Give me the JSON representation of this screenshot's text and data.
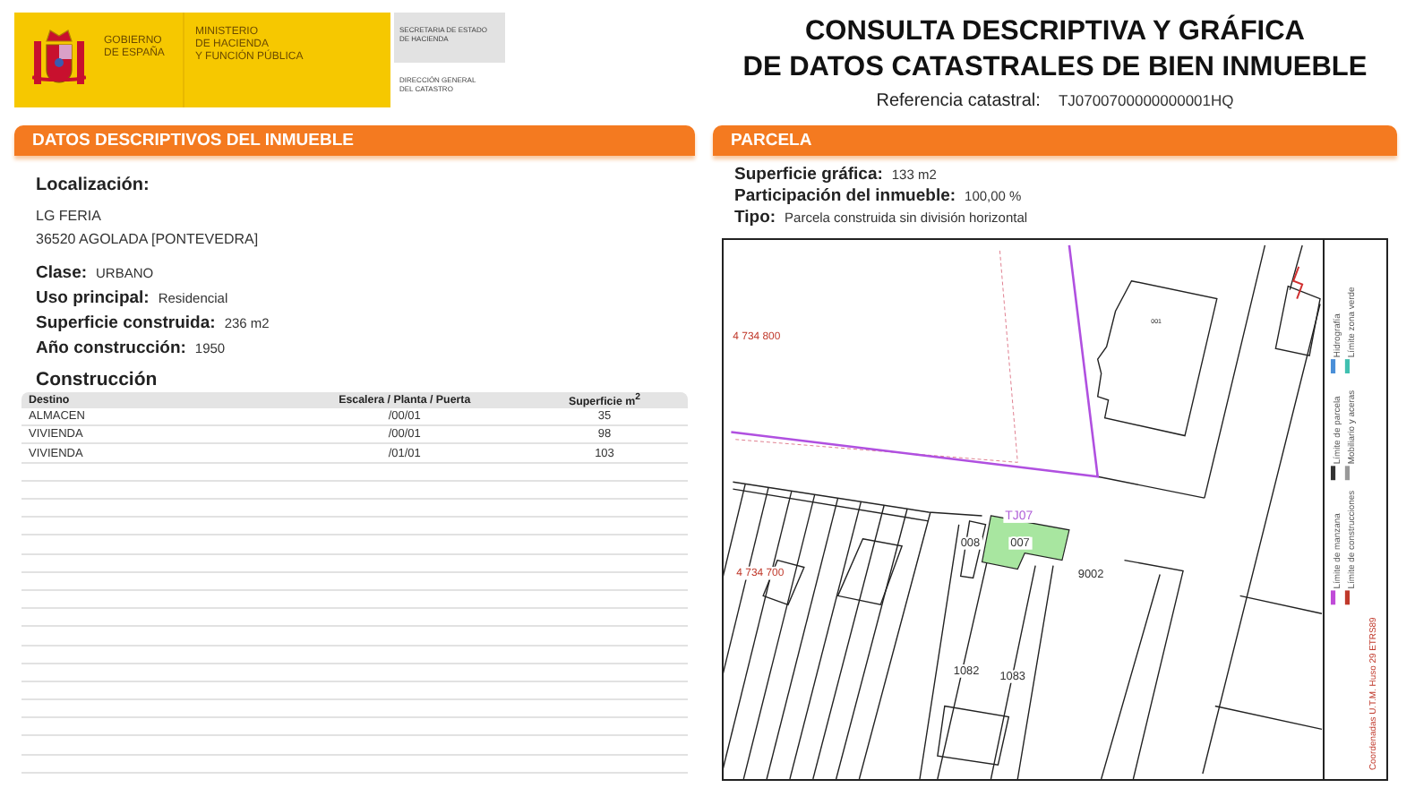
{
  "header": {
    "government": [
      "GOBIERNO",
      "DE ESPAÑA"
    ],
    "ministry": [
      "MINISTERIO",
      "DE HACIENDA",
      "Y FUNCIÓN PÚBLICA"
    ],
    "secretariat": [
      "SECRETARIA DE ESTADO",
      "DE HACIENDA"
    ],
    "directorate": [
      "DIRECCIÓN GENERAL",
      "DEL CATASTRO"
    ],
    "title_lines": [
      "CONSULTA DESCRIPTIVA Y GRÁFICA",
      "DE DATOS CATASTRALES DE BIEN INMUEBLE"
    ],
    "reference": {
      "label": "Referencia catastral:",
      "value": "TJ0700700000000001HQ"
    }
  },
  "property": {
    "title": "DATOS DESCRIPTIVOS DEL **INMUEBLE**",
    "location": {
      "label": "Localización:",
      "lines": [
        "LG FERIA",
        "36520 AGOLADA [PONTEVEDRA]"
      ]
    },
    "fields": [
      {
        "label": "Clase:",
        "value": "URBANO"
      },
      {
        "label": "Uso principal:",
        "value": "Residencial"
      },
      {
        "label": "Superficie construida:",
        "value": "236 m2"
      },
      {
        "label": "Año construcción:",
        "value": "1950"
      }
    ],
    "construction": {
      "title": "Construcción",
      "columns": [
        "Destino",
        "Escalera / Planta / Puerta",
        "Superficie m$^{2}$"
      ],
      "rows": [
        [
          "ALMACEN",
          "/00/01",
          "35"
        ],
        [
          "VIVIENDA",
          "/00/01",
          "98"
        ],
        [
          "VIVIENDA",
          "/01/01",
          "103"
        ]
      ]
    }
  },
  "parcel": {
    "title": "PARCELA",
    "fields": [
      {
        "label": "Superficie gráfica:",
        "value": "133 m2"
      },
      {
        "label": "Participación del inmueble:",
        "value": "100,00 %"
      },
      {
        "label": "Tipo:",
        "value": "Parcela construida sin división horizontal"
      }
    ],
    "map": {
      "labels": [
        {
          "text": "4 734 800",
          "kind": "coordinate"
        },
        {
          "text": "001",
          "kind": "building"
        },
        {
          "text": "TJ07",
          "kind": "block"
        },
        {
          "text": "008",
          "kind": "parcel"
        },
        {
          "text": "007",
          "kind": "parcel"
        },
        {
          "text": "4 734 700",
          "kind": "coordinate"
        },
        {
          "text": "9002",
          "kind": "parcel"
        },
        {
          "text": "1082",
          "kind": "parcel"
        },
        {
          "text": "1083",
          "kind": "parcel"
        }
      ],
      "legend": [
        {
          "label": "Hidrografía",
          "color": "#4a8fd8"
        },
        {
          "label": "Límite zona verde",
          "color": "#40c0b0"
        },
        {
          "label": "Límite de parcela",
          "color": "#333333"
        },
        {
          "label": "Mobiliario y aceras",
          "color": "#999999"
        },
        {
          "label": "Límite de manzana",
          "color": "#c04bd8"
        },
        {
          "label": "Límite de construcciones",
          "color": "#c0392b"
        }
      ],
      "scale_text": "Coordenadas U.T.M. Huso 29 ETRS89"
    }
  }
}
